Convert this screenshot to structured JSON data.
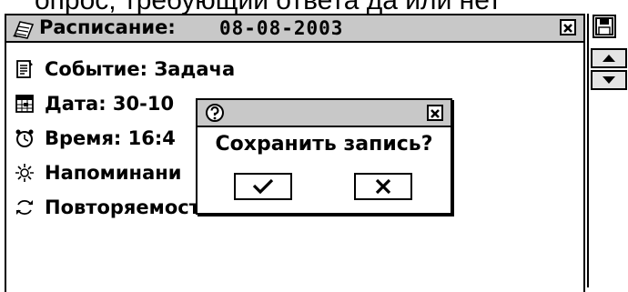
{
  "banner": {
    "text": "опрос, требующий ответа да или нет"
  },
  "window": {
    "title_label": "Расписание:",
    "title_date": "08-08-2003",
    "icons": {
      "title": "notebook-icon",
      "close": "close-icon"
    }
  },
  "fields": {
    "event": "Событие: Задача",
    "date": "Дата: 30-10",
    "time": "Время: 16:4",
    "reminder": "Напоминани",
    "repeat": "Повторяемость: нет"
  },
  "sidebar": {
    "icons": {
      "save": "floppy-disk-icon",
      "up": "scroll-up-icon",
      "down": "scroll-down-icon"
    }
  },
  "dialog": {
    "message": "Сохранить  запись?",
    "icons": {
      "question": "question-icon",
      "close": "close-icon",
      "ok": "check-icon",
      "cancel": "x-icon"
    }
  }
}
